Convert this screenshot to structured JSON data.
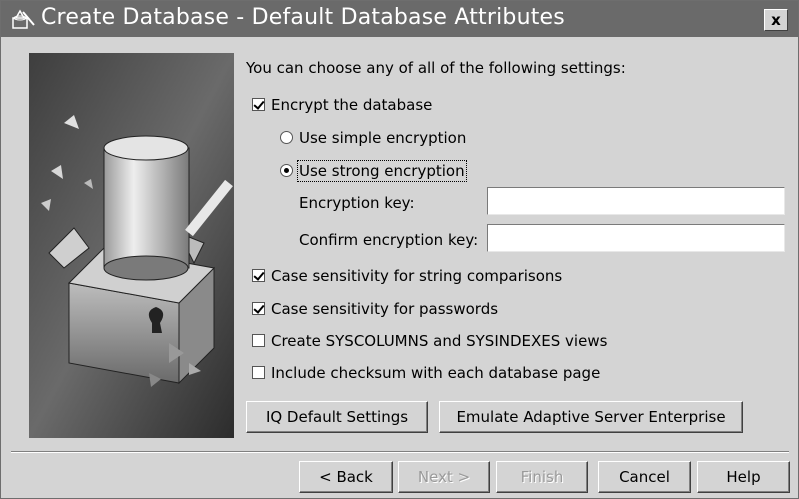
{
  "window": {
    "title": "Create Database - Default Database Attributes",
    "close_label": "x"
  },
  "intro": "You can choose any of all of the following settings:",
  "options": {
    "encrypt": {
      "label": "Encrypt the database",
      "checked": true
    },
    "simple_encryption": {
      "label": "Use simple encryption",
      "selected": false
    },
    "strong_encryption": {
      "label": "Use strong encryption",
      "selected": true
    },
    "encryption_key": {
      "label": "Encryption key:",
      "value": ""
    },
    "confirm_key": {
      "label": "Confirm encryption key:",
      "value": ""
    },
    "case_strings": {
      "label": "Case sensitivity for string comparisons",
      "checked": true
    },
    "case_passwords": {
      "label": "Case sensitivity for passwords",
      "checked": true
    },
    "syscolumns": {
      "label": "Create SYSCOLUMNS and SYSINDEXES views",
      "checked": false
    },
    "checksum": {
      "label": "Include checksum with each database page",
      "checked": false
    }
  },
  "preset_buttons": {
    "iq_default": "IQ Default Settings",
    "emulate_ase": "Emulate Adaptive Server Enterprise"
  },
  "footer_buttons": {
    "back": "< Back",
    "next": "Next >",
    "finish": "Finish",
    "cancel": "Cancel",
    "help": "Help"
  },
  "icons": {
    "title": "database-wizard-icon",
    "art": "database-cylinder-illustration"
  },
  "colors": {
    "titlebar": "#6a6a6a",
    "dialog": "#d4d4d4"
  }
}
